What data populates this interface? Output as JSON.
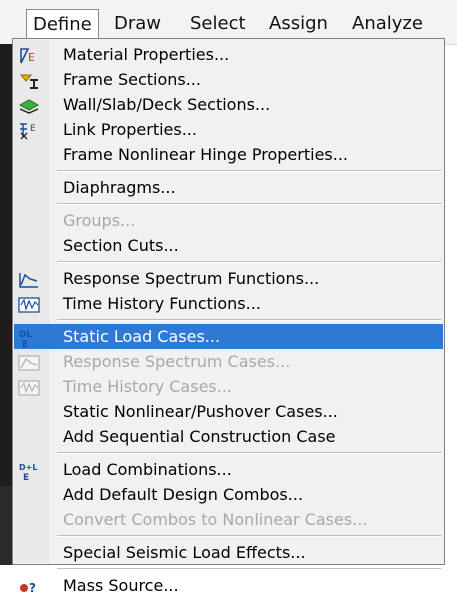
{
  "menubar": {
    "items": [
      {
        "label": "Define"
      },
      {
        "label": "Draw"
      },
      {
        "label": "Select"
      },
      {
        "label": "Assign"
      },
      {
        "label": "Analyze"
      }
    ]
  },
  "menu": {
    "items": [
      {
        "label": "Material Properties...",
        "icon": "material-properties-icon"
      },
      {
        "label": "Frame Sections...",
        "icon": "frame-sections-icon"
      },
      {
        "label": "Wall/Slab/Deck Sections...",
        "icon": "wall-slab-deck-icon"
      },
      {
        "label": "Link Properties...",
        "icon": "link-properties-icon"
      },
      {
        "label": "Frame Nonlinear Hinge Properties..."
      },
      {
        "label": "Diaphragms..."
      },
      {
        "label": "Groups...",
        "disabled": true
      },
      {
        "label": "Section Cuts..."
      },
      {
        "label": "Response Spectrum Functions...",
        "icon": "response-spectrum-function-icon"
      },
      {
        "label": "Time History Functions...",
        "icon": "time-history-function-icon"
      },
      {
        "label": "Static Load Cases...",
        "icon": "static-load-cases-icon",
        "highlighted": true
      },
      {
        "label": "Response Spectrum Cases...",
        "icon": "response-spectrum-cases-icon",
        "disabled": true
      },
      {
        "label": "Time History Cases...",
        "icon": "time-history-cases-icon",
        "disabled": true
      },
      {
        "label": "Static Nonlinear/Pushover Cases..."
      },
      {
        "label": "Add Sequential Construction Case"
      },
      {
        "label": "Load Combinations...",
        "icon": "load-combinations-icon"
      },
      {
        "label": "Add Default Design Combos..."
      },
      {
        "label": "Convert Combos to Nonlinear Cases...",
        "disabled": true
      },
      {
        "label": "Special Seismic Load Effects..."
      },
      {
        "label": "Mass Source...",
        "icon": "mass-source-icon"
      }
    ]
  },
  "colors": {
    "highlight": "#2c7ad6",
    "disabled_text": "#a8a8a8",
    "menu_bg": "#f1f1f1"
  }
}
